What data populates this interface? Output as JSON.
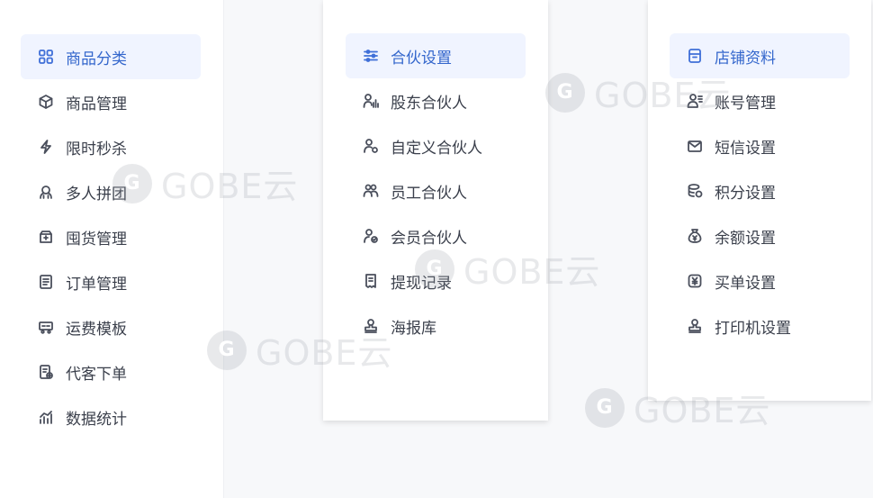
{
  "panel1": {
    "items": [
      {
        "label": "商品分类",
        "icon": "grid-icon",
        "active": true
      },
      {
        "label": "商品管理",
        "icon": "box-icon"
      },
      {
        "label": "限时秒杀",
        "icon": "lightning-icon"
      },
      {
        "label": "多人拼团",
        "icon": "group-icon"
      },
      {
        "label": "囤货管理",
        "icon": "storage-icon"
      },
      {
        "label": "订单管理",
        "icon": "order-icon"
      },
      {
        "label": "运费模板",
        "icon": "truck-icon"
      },
      {
        "label": "代客下单",
        "icon": "proxy-order-icon"
      },
      {
        "label": "数据统计",
        "icon": "chart-icon"
      }
    ]
  },
  "panel2": {
    "items": [
      {
        "label": "合伙设置",
        "icon": "sliders-icon",
        "active": true
      },
      {
        "label": "股东合伙人",
        "icon": "shareholder-icon"
      },
      {
        "label": "自定义合伙人",
        "icon": "custom-partner-icon"
      },
      {
        "label": "员工合伙人",
        "icon": "staff-icon"
      },
      {
        "label": "会员合伙人",
        "icon": "member-icon"
      },
      {
        "label": "提现记录",
        "icon": "receipt-icon"
      },
      {
        "label": "海报库",
        "icon": "stamp-icon"
      }
    ]
  },
  "panel3": {
    "items": [
      {
        "label": "店铺资料",
        "icon": "store-icon",
        "active": true
      },
      {
        "label": "账号管理",
        "icon": "account-icon"
      },
      {
        "label": "短信设置",
        "icon": "mail-icon"
      },
      {
        "label": "积分设置",
        "icon": "coins-icon"
      },
      {
        "label": "余额设置",
        "icon": "money-bag-icon"
      },
      {
        "label": "买单设置",
        "icon": "yen-icon"
      },
      {
        "label": "打印机设置",
        "icon": "stamp-icon"
      }
    ]
  },
  "watermark": {
    "text": "GOBE云",
    "logo": "G"
  },
  "colors": {
    "active_bg": "#f0f4ff",
    "active_text": "#3366cc",
    "text": "#3a3f4b"
  }
}
